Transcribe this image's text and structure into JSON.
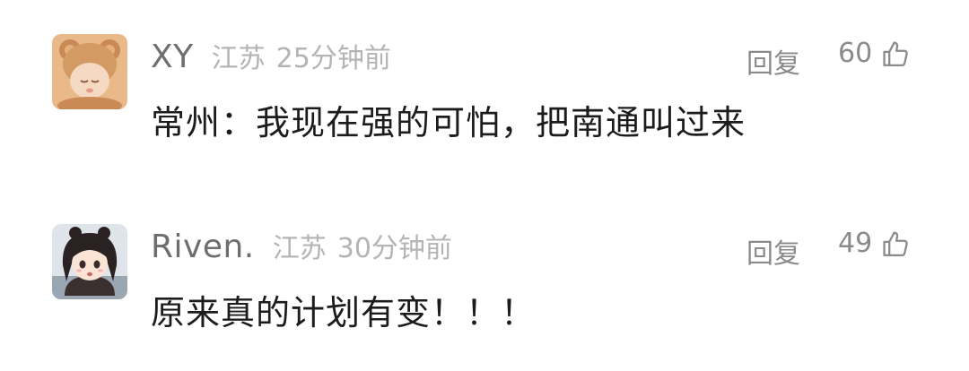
{
  "comments": [
    {
      "username": "XY",
      "location": "江苏",
      "time": "25分钟前",
      "reply_label": "回复",
      "likes": "60",
      "content": "常州：我现在强的可怕，把南通叫过来",
      "avatar_icon": "teddy-bear-baby-avatar"
    },
    {
      "username": "Riven.",
      "location": "江苏",
      "time": "30分钟前",
      "reply_label": "回复",
      "likes": "49",
      "content": "原来真的计划有变！！！",
      "avatar_icon": "anime-girl-avatar"
    }
  ],
  "colors": {
    "username": "#6e6e6e",
    "meta": "#b4b4b4",
    "action": "#8a8a8a",
    "content": "#1c1c1c"
  }
}
